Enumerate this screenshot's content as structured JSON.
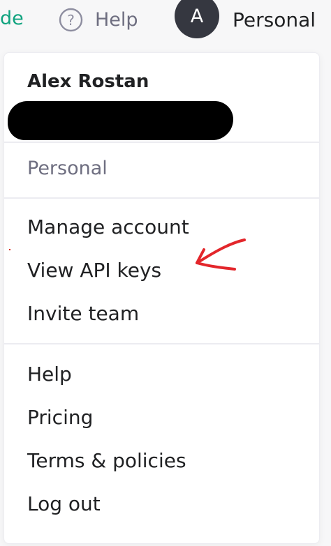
{
  "topbar": {
    "upgrade_label": "de",
    "help_label": "Help",
    "avatar_initial": "A",
    "account_label": "Personal"
  },
  "menu": {
    "user_name": "Alex Rostan",
    "org_label": "Personal",
    "account_items": [
      {
        "label": "Manage account"
      },
      {
        "label": "View API keys"
      },
      {
        "label": "Invite team"
      }
    ],
    "help_items": [
      {
        "label": "Help"
      },
      {
        "label": "Pricing"
      },
      {
        "label": "Terms & policies"
      },
      {
        "label": "Log out"
      }
    ]
  },
  "colors": {
    "accent": "#10a37f",
    "avatar_bg": "#353740",
    "annotation": "#e3262b",
    "muted_text": "#6e6e80"
  },
  "icons": [
    "help-circle-icon"
  ]
}
